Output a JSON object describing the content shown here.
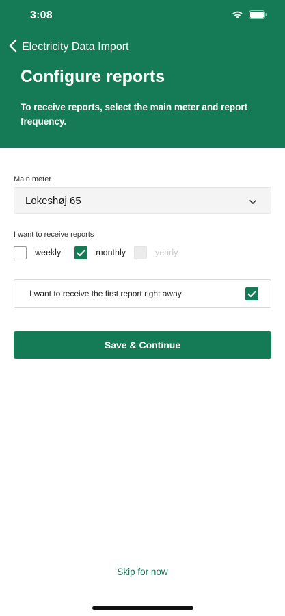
{
  "status_bar": {
    "time": "3:08"
  },
  "nav": {
    "back_label": "Electricity Data Import"
  },
  "header": {
    "title": "Configure reports",
    "subtitle": "To receive reports, select the main meter and report frequency."
  },
  "main_meter": {
    "label": "Main meter",
    "selected": "Lokeshøj 65"
  },
  "frequency": {
    "label": "I want to receive reports",
    "options": [
      {
        "label": "weekly",
        "checked": false,
        "disabled": false
      },
      {
        "label": "monthly",
        "checked": true,
        "disabled": false
      },
      {
        "label": "yearly",
        "checked": false,
        "disabled": true
      }
    ]
  },
  "first_report": {
    "label": "I want to receive the first report right away",
    "checked": true
  },
  "actions": {
    "primary_label": "Save & Continue",
    "skip_label": "Skip for now"
  },
  "colors": {
    "brand": "#157a56",
    "disabled": "#c9c9c9"
  },
  "icons": [
    "chevron-left-icon",
    "wifi-icon",
    "battery-icon",
    "chevron-down-icon",
    "checkmark-icon"
  ]
}
